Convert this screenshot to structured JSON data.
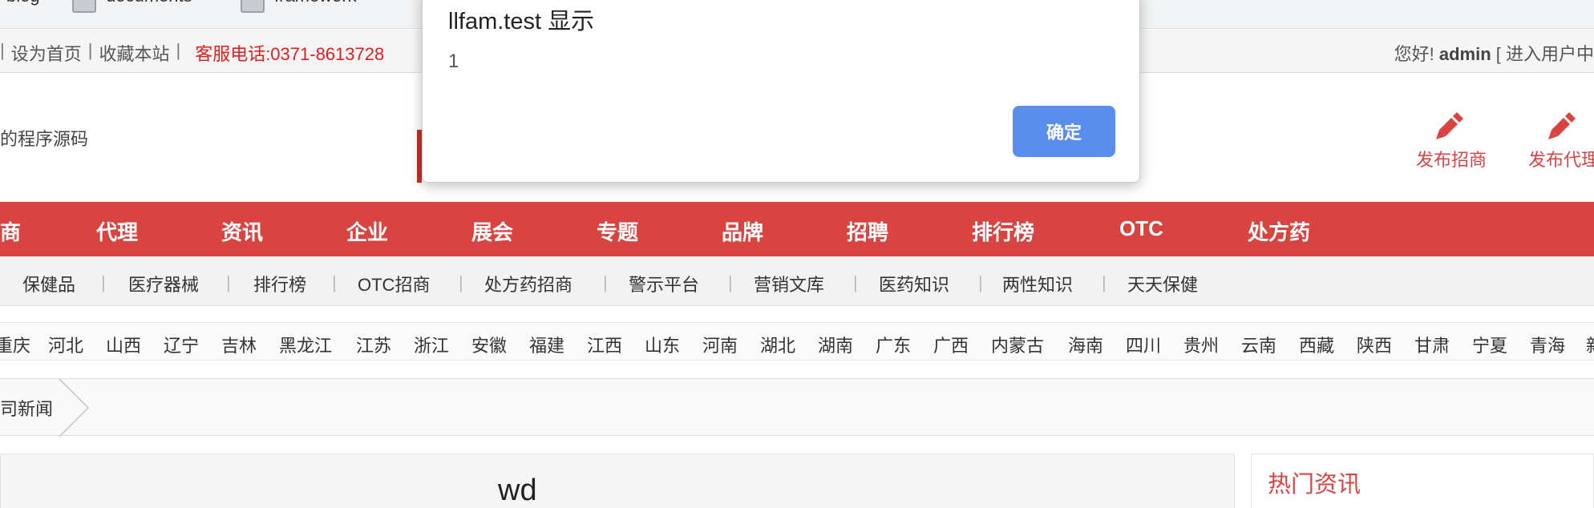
{
  "browser": {
    "bookmarks": [
      {
        "label": "blog"
      },
      {
        "label": "documents"
      },
      {
        "label": "framework"
      }
    ]
  },
  "topbar": {
    "set_home": "设为首页",
    "favorite": "收藏本站",
    "phone": "客服电话:0371-8613728",
    "greeting": "您好!",
    "username": "admin",
    "user_center": "[ 进入用户中"
  },
  "header": {
    "slogan": "的程序源码",
    "post_invest": "发布招商",
    "post_agent": "发布代理"
  },
  "mainnav": [
    "商",
    "代理",
    "资讯",
    "企业",
    "展会",
    "专题",
    "品牌",
    "招聘",
    "排行榜",
    "OTC",
    "处方药"
  ],
  "subnav": [
    "保健品",
    "医疗器械",
    "排行榜",
    "OTC招商",
    "处方药招商",
    "警示平台",
    "营销文库",
    "医药知识",
    "两性知识",
    "天天保健"
  ],
  "provinces": [
    "重庆",
    "河北",
    "山西",
    "辽宁",
    "吉林",
    "黑龙江",
    "江苏",
    "浙江",
    "安徽",
    "福建",
    "江西",
    "山东",
    "河南",
    "湖北",
    "湖南",
    "广东",
    "广西",
    "内蒙古",
    "海南",
    "四川",
    "贵州",
    "云南",
    "西藏",
    "陕西",
    "甘肃",
    "宁夏",
    "青海",
    "新"
  ],
  "breadcrumb": {
    "current": "司新闻"
  },
  "article": {
    "title": "wd"
  },
  "sidebar": {
    "title": "热门资讯"
  },
  "dialog": {
    "title": "llfam.test 显示",
    "message": "1",
    "ok_label": "确定"
  },
  "colors": {
    "brand_red": "#d94441",
    "phone_red": "#e02020",
    "dialog_button": "#5b8ded"
  }
}
